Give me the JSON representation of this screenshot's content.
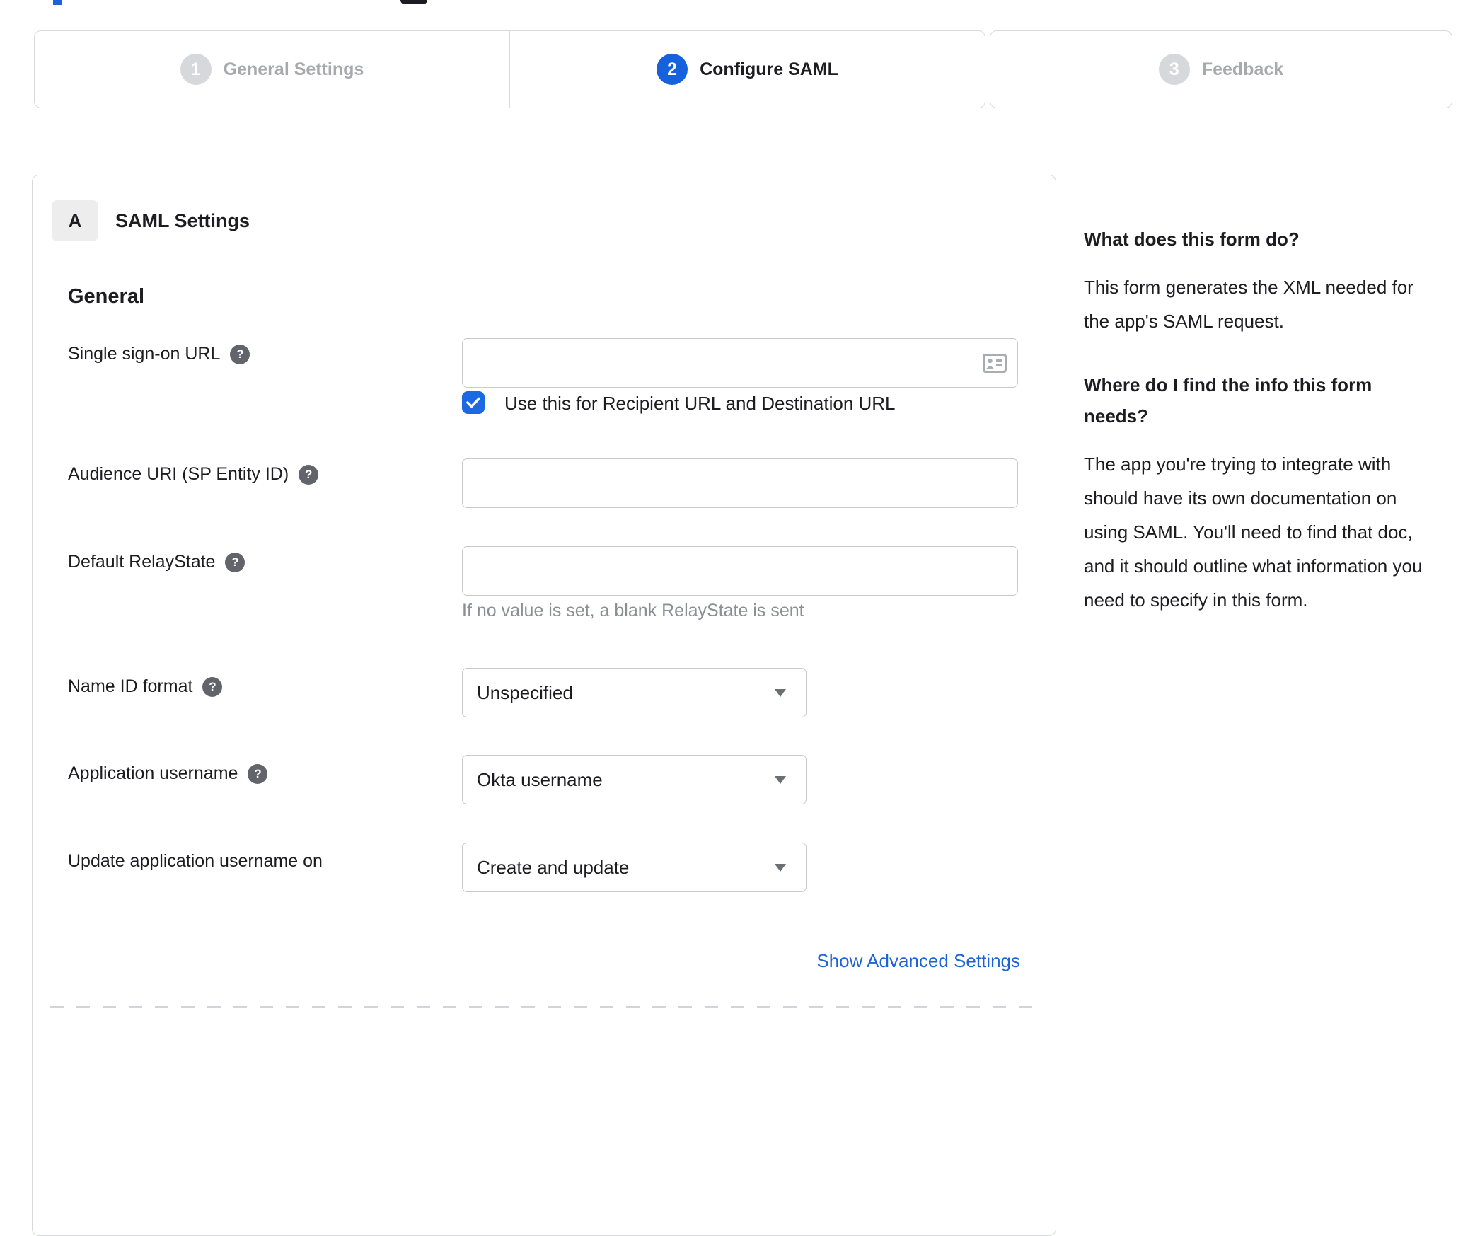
{
  "stepper": {
    "steps": [
      {
        "number": "1",
        "label": "General Settings",
        "state": "inactive"
      },
      {
        "number": "2",
        "label": "Configure SAML",
        "state": "active"
      },
      {
        "number": "3",
        "label": "Feedback",
        "state": "inactive"
      }
    ]
  },
  "panel": {
    "section_badge": "A",
    "section_title": "SAML Settings",
    "group_title": "General",
    "help_glyph": "?",
    "fields": {
      "sso": {
        "label": "Single sign-on URL",
        "value": "",
        "checkbox_label": "Use this for Recipient URL and Destination URL",
        "checkbox_checked": true
      },
      "audience": {
        "label": "Audience URI (SP Entity ID)",
        "value": ""
      },
      "relay": {
        "label": "Default RelayState",
        "value": "",
        "hint": "If no value is set, a blank RelayState is sent"
      },
      "name_id": {
        "label": "Name ID format",
        "value": "Unspecified"
      },
      "app_username": {
        "label": "Application username",
        "value": "Okta username"
      },
      "update_username": {
        "label": "Update application username on",
        "value": "Create and update"
      }
    },
    "advanced_link": "Show Advanced Settings"
  },
  "sidebar": {
    "sections": [
      {
        "heading": "What does this form do?",
        "body": "This form generates the XML needed for the app's SAML request."
      },
      {
        "heading": "Where do I find the info this form needs?",
        "body": "The app you're trying to integrate with should have its own documentation on using SAML. You'll need to find that doc, and it should outline what information you need to specify in this form."
      }
    ]
  },
  "colors": {
    "accent_blue": "#1662dd",
    "checkbox_blue": "#1b6ae4",
    "link_blue": "#1b63d6",
    "inactive_gray": "#a7a9ad",
    "border_gray": "#d8d9dc",
    "text_dark": "#1d1d21"
  }
}
